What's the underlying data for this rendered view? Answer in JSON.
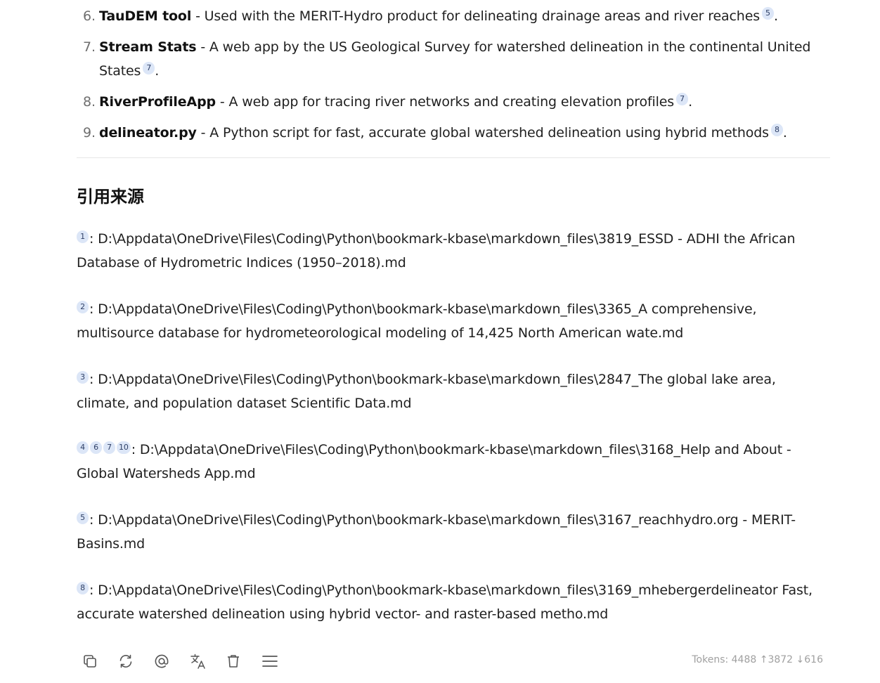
{
  "tools": [
    {
      "num": "6.",
      "name": "TauDEM tool",
      "desc": " - Used with the MERIT-Hydro product for delineating drainage areas and river reaches",
      "cites": [
        "5"
      ],
      "end": "."
    },
    {
      "num": "7.",
      "name": "Stream Stats",
      "desc": " - A web app by the US Geological Survey for watershed delineation in the continental United States",
      "cites": [
        "7"
      ],
      "end": "."
    },
    {
      "num": "8.",
      "name": "RiverProfileApp",
      "desc": " - A web app for tracing river networks and creating elevation profiles",
      "cites": [
        "7"
      ],
      "end": "."
    },
    {
      "num": "9.",
      "name": "delineator.py",
      "desc": " - A Python script for fast, accurate global watershed delineation using hybrid methods",
      "cites": [
        "8"
      ],
      "end": "."
    }
  ],
  "sources_heading": "引用来源",
  "sources": [
    {
      "cites": [
        "1"
      ],
      "text": ": D:\\Appdata\\OneDrive\\Files\\Coding\\Python\\bookmark-kbase\\markdown_files\\3819_ESSD - ADHI the African Database of Hydrometric Indices (1950–2018).md"
    },
    {
      "cites": [
        "2"
      ],
      "text": ": D:\\Appdata\\OneDrive\\Files\\Coding\\Python\\bookmark-kbase\\markdown_files\\3365_A comprehensive, multisource database for hydrometeorological modeling of 14,425 North American wate.md"
    },
    {
      "cites": [
        "3"
      ],
      "text": ": D:\\Appdata\\OneDrive\\Files\\Coding\\Python\\bookmark-kbase\\markdown_files\\2847_The global lake area, climate, and population dataset  Scientific Data.md"
    },
    {
      "cites": [
        "4",
        "6",
        "7",
        "10"
      ],
      "text": ": D:\\Appdata\\OneDrive\\Files\\Coding\\Python\\bookmark-kbase\\markdown_files\\3168_Help and About - Global Watersheds App.md"
    },
    {
      "cites": [
        "5"
      ],
      "text": ": D:\\Appdata\\OneDrive\\Files\\Coding\\Python\\bookmark-kbase\\markdown_files\\3167_reachhydro.org - MERIT-Basins.md"
    },
    {
      "cites": [
        "8"
      ],
      "text": ": D:\\Appdata\\OneDrive\\Files\\Coding\\Python\\bookmark-kbase\\markdown_files\\3169_mhebergerdelineator Fast, accurate watershed delineation using hybrid vector- and raster-based metho.md"
    }
  ],
  "toolbar": {
    "icons": [
      "copy-icon",
      "regenerate-icon",
      "mention-icon",
      "translate-icon",
      "delete-icon",
      "menu-icon"
    ]
  },
  "tokens_text": "Tokens: 4488 ↑3872 ↓616",
  "colors": {
    "cite_bg": "#dce6f7",
    "cite_fg": "#2e3f66",
    "muted": "#a0a0a0"
  }
}
